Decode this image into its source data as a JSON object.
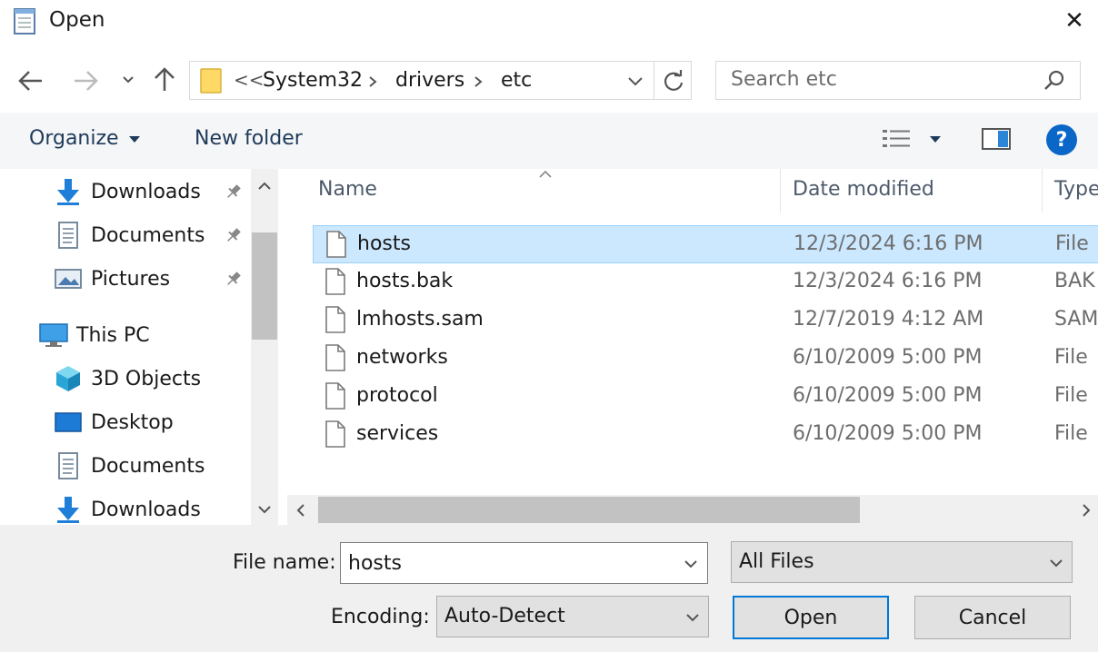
{
  "window": {
    "title": "Open",
    "close_glyph": "✕"
  },
  "address": {
    "overflow": "<<",
    "crumbs": [
      "System32",
      "drivers",
      "etc"
    ]
  },
  "search": {
    "placeholder": "Search etc"
  },
  "toolbar": {
    "organize_label": "Organize",
    "new_folder_label": "New folder",
    "help_glyph": "?"
  },
  "nav": {
    "quick_access": [
      {
        "label": "Downloads",
        "icon": "download-arrow-icon",
        "pinned": true
      },
      {
        "label": "Documents",
        "icon": "document-icon",
        "pinned": true
      },
      {
        "label": "Pictures",
        "icon": "pictures-icon",
        "pinned": true
      }
    ],
    "this_pc_label": "This PC",
    "this_pc_items": [
      {
        "label": "3D Objects",
        "icon": "3d-objects-icon"
      },
      {
        "label": "Desktop",
        "icon": "desktop-icon"
      },
      {
        "label": "Documents",
        "icon": "document-icon"
      },
      {
        "label": "Downloads",
        "icon": "download-arrow-icon"
      }
    ]
  },
  "columns": {
    "name": "Name",
    "date": "Date modified",
    "type": "Type"
  },
  "files": [
    {
      "name": "hosts",
      "date": "12/3/2024 6:16 PM",
      "type": "File",
      "selected": true
    },
    {
      "name": "hosts.bak",
      "date": "12/3/2024 6:16 PM",
      "type": "BAK",
      "selected": false
    },
    {
      "name": "lmhosts.sam",
      "date": "12/7/2019 4:12 AM",
      "type": "SAM",
      "selected": false
    },
    {
      "name": "networks",
      "date": "6/10/2009 5:00 PM",
      "type": "File",
      "selected": false
    },
    {
      "name": "protocol",
      "date": "6/10/2009 5:00 PM",
      "type": "File",
      "selected": false
    },
    {
      "name": "services",
      "date": "6/10/2009 5:00 PM",
      "type": "File",
      "selected": false
    }
  ],
  "bottom": {
    "filename_label": "File name:",
    "filename_value": "hosts",
    "filetype_value": "All Files",
    "encoding_label": "Encoding:",
    "encoding_value": "Auto-Detect",
    "open_label": "Open",
    "cancel_label": "Cancel"
  },
  "colors": {
    "accent": "#0078d7",
    "selection": "#cce8ff",
    "selection_border": "#99d1ff",
    "folder": "#ffd966"
  }
}
